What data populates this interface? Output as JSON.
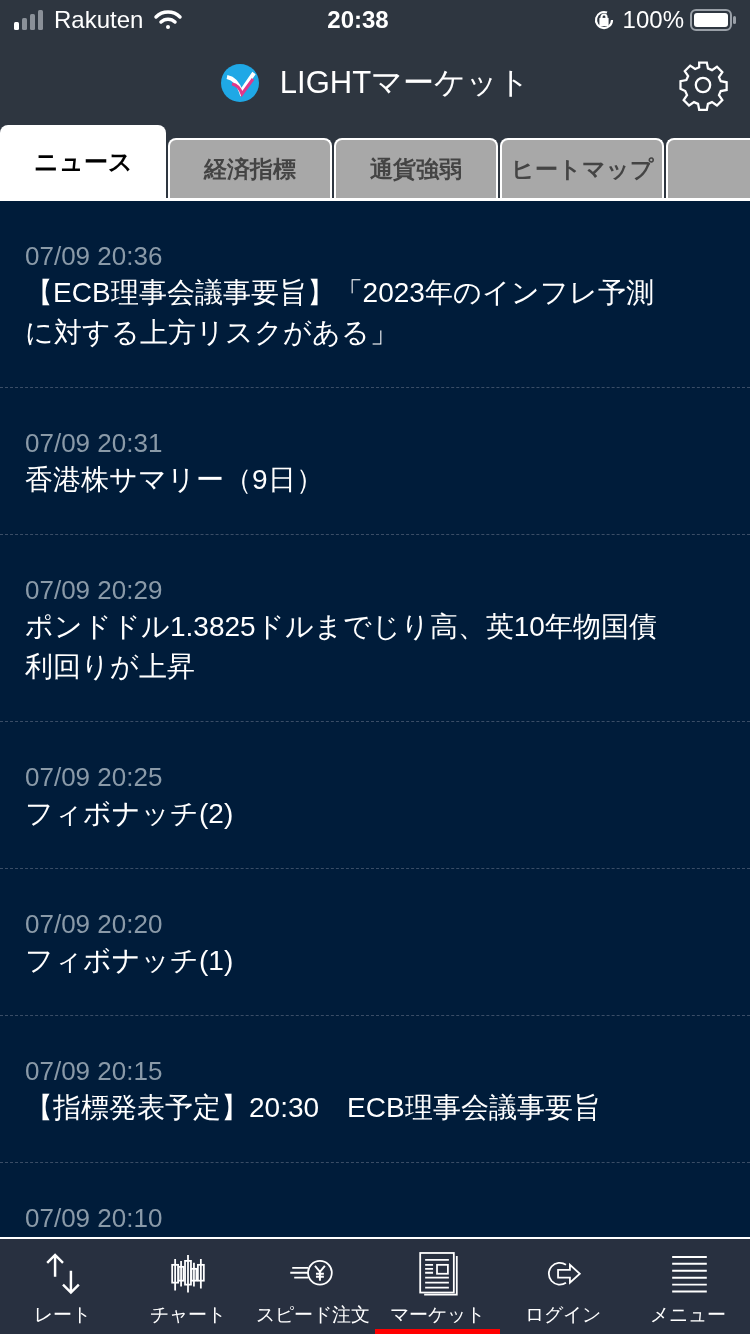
{
  "status_bar": {
    "carrier": "Rakuten",
    "time": "20:38",
    "battery": "100%"
  },
  "header": {
    "title": "LIGHTマーケット"
  },
  "tabs": [
    {
      "label": "ニュース",
      "selected": true
    },
    {
      "label": "経済指標",
      "selected": false
    },
    {
      "label": "通貨強弱",
      "selected": false
    },
    {
      "label": "ヒートマップ",
      "selected": false
    }
  ],
  "news": [
    {
      "time": "07/09 20:36",
      "title": "【ECB理事会議事要旨】「2023年のインフレ予測に対する上方リスクがある」"
    },
    {
      "time": "07/09 20:31",
      "title": "香港株サマリー（9日）"
    },
    {
      "time": "07/09 20:29",
      "title": "ポンドドル1.3825ドルまでじり高、英10年物国債利回りが上昇"
    },
    {
      "time": "07/09 20:25",
      "title": "フィボナッチ(2)"
    },
    {
      "time": "07/09 20:20",
      "title": "フィボナッチ(1)"
    },
    {
      "time": "07/09 20:15",
      "title": "【指標発表予定】20:30　ECB理事会議事要旨"
    },
    {
      "time": "07/09 20:10"
    }
  ],
  "bottom_nav": [
    {
      "kind": "rate",
      "label": "レート",
      "selected": false
    },
    {
      "kind": "chart",
      "label": "チャート",
      "selected": false
    },
    {
      "kind": "speed",
      "label": "スピード注文",
      "selected": false
    },
    {
      "kind": "market",
      "label": "マーケット",
      "selected": true
    },
    {
      "kind": "login",
      "label": "ログイン",
      "selected": false
    },
    {
      "kind": "menu",
      "label": "メニュー",
      "selected": false
    }
  ]
}
